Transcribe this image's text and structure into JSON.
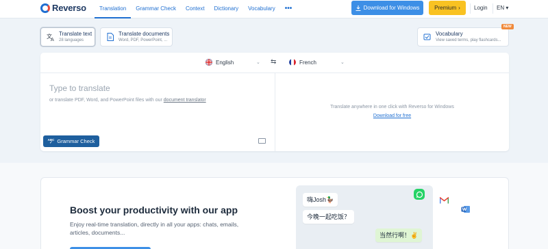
{
  "header": {
    "logo_text": "Reverso",
    "nav": [
      {
        "label": "Translation",
        "active": true
      },
      {
        "label": "Grammar Check",
        "active": false
      },
      {
        "label": "Context",
        "active": false
      },
      {
        "label": "Dictionary",
        "active": false
      },
      {
        "label": "Vocabulary",
        "active": false
      }
    ],
    "more_label": "•••",
    "download_label": "Download for Windows",
    "premium_label": "Premium",
    "login_label": "Login",
    "lang_label": "EN ▾"
  },
  "modes": {
    "text": {
      "title": "Translate text",
      "sub": "28 languages"
    },
    "docs": {
      "title": "Translate documents",
      "sub": "Word, PDF, PowerPoint, ..."
    },
    "vocab": {
      "title": "Vocabulary",
      "sub": "View saved terms, play flashcards...",
      "badge": "NEW"
    }
  },
  "translator": {
    "source_lang": "English",
    "target_lang": "French",
    "placeholder": "Type to translate",
    "hint_prefix": "or translate PDF, Word, and PowerPoint files with our ",
    "hint_link": "document translator",
    "grammar_label": "Grammar Check",
    "grammar_badge": "ABC",
    "target_message": "Translate anywhere in one click with Reverso for Windows",
    "target_link": "Download for free"
  },
  "promo": {
    "title": "Boost your productivity with our app",
    "description": "Enjoy real-time translation, directly in all your apps: chats, emails, articles, documents...",
    "chat": [
      {
        "text": "嗨Josh🦆",
        "from": "them"
      },
      {
        "text": "今晚一起吃饭？",
        "from": "them"
      },
      {
        "text": "当然行啊！✌",
        "from": "me"
      }
    ]
  },
  "colors": {
    "accent": "#1f6fd1",
    "download_button": "#3d8fe6",
    "premium_button": "#f9c222",
    "grammar_button": "#1e5f9e",
    "new_badge": "#f08a3c"
  }
}
